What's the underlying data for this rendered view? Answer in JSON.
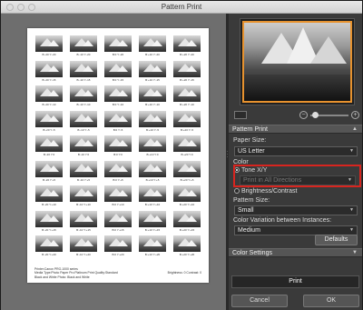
{
  "window": {
    "title": "Pattern Print"
  },
  "paper": {
    "cells": [
      "B:-20 Y:-20",
      "B:-10 Y:-20",
      "B:0 Y:-20",
      "B:+10 Y:-20",
      "B:+20 Y:-20",
      "B:-20 Y:-15",
      "B:-10 Y:-15",
      "B:0 Y:-15",
      "B:+10 Y:-15",
      "B:+20 Y:-15",
      "B:-20 Y:-10",
      "B:-10 Y:-10",
      "B:0 Y:-10",
      "B:+10 Y:-10",
      "B:+20 Y:-10",
      "B:-20 Y:-5",
      "B:-10 Y:-5",
      "B:0 Y:-5",
      "B:+10 Y:-5",
      "B:+20 Y:-5",
      "B:-20 Y:0",
      "B:-10 Y:0",
      "B:0 Y:0",
      "B:+10 Y:0",
      "B:+20 Y:0",
      "B:-20 Y:+5",
      "B:-10 Y:+5",
      "B:0 Y:+5",
      "B:+10 Y:+5",
      "B:+20 Y:+5",
      "B:-20 Y:+10",
      "B:-10 Y:+10",
      "B:0 Y:+10",
      "B:+10 Y:+10",
      "B:+20 Y:+10",
      "B:-20 Y:+15",
      "B:-10 Y:+15",
      "B:0 Y:+15",
      "B:+10 Y:+15",
      "B:+20 Y:+15",
      "B:-20 Y:+20",
      "B:-10 Y:+20",
      "B:0 Y:+20",
      "B:+10 Y:+20",
      "B:+20 Y:+20"
    ],
    "footer_line1": "Printer:Canon PRO-1000 series",
    "footer_line2": "Media Type:Photo Paper Pro Platinum    Print Quality:Standard",
    "footer_line3": "Black and White Photo: Black and White",
    "footer_right": "Brightness: 0  Contrast: 0"
  },
  "panel": {
    "section_pattern": "Pattern Print",
    "paper_size_label": "Paper Size:",
    "paper_size_value": "US Letter",
    "color_label": "Color",
    "radio_tone": "Tone X/Y",
    "tone_select_value": "Print in All Directions",
    "radio_brightness": "Brightness/Contrast",
    "pattern_size_label": "Pattern Size:",
    "pattern_size_value": "Small",
    "variation_label": "Color Variation between Instances:",
    "variation_value": "Medium",
    "defaults_button": "Defaults",
    "section_color_settings": "Color Settings",
    "print_button": "Print",
    "cancel_button": "Cancel",
    "ok_button": "OK"
  },
  "icons": {
    "zoom_out": "minus-icon",
    "zoom_in": "plus-icon",
    "collapse": "triangle-up-icon",
    "expand": "triangle-down-icon"
  },
  "colors": {
    "highlight": "#d8251f",
    "nav_frame": "#e7922e"
  }
}
